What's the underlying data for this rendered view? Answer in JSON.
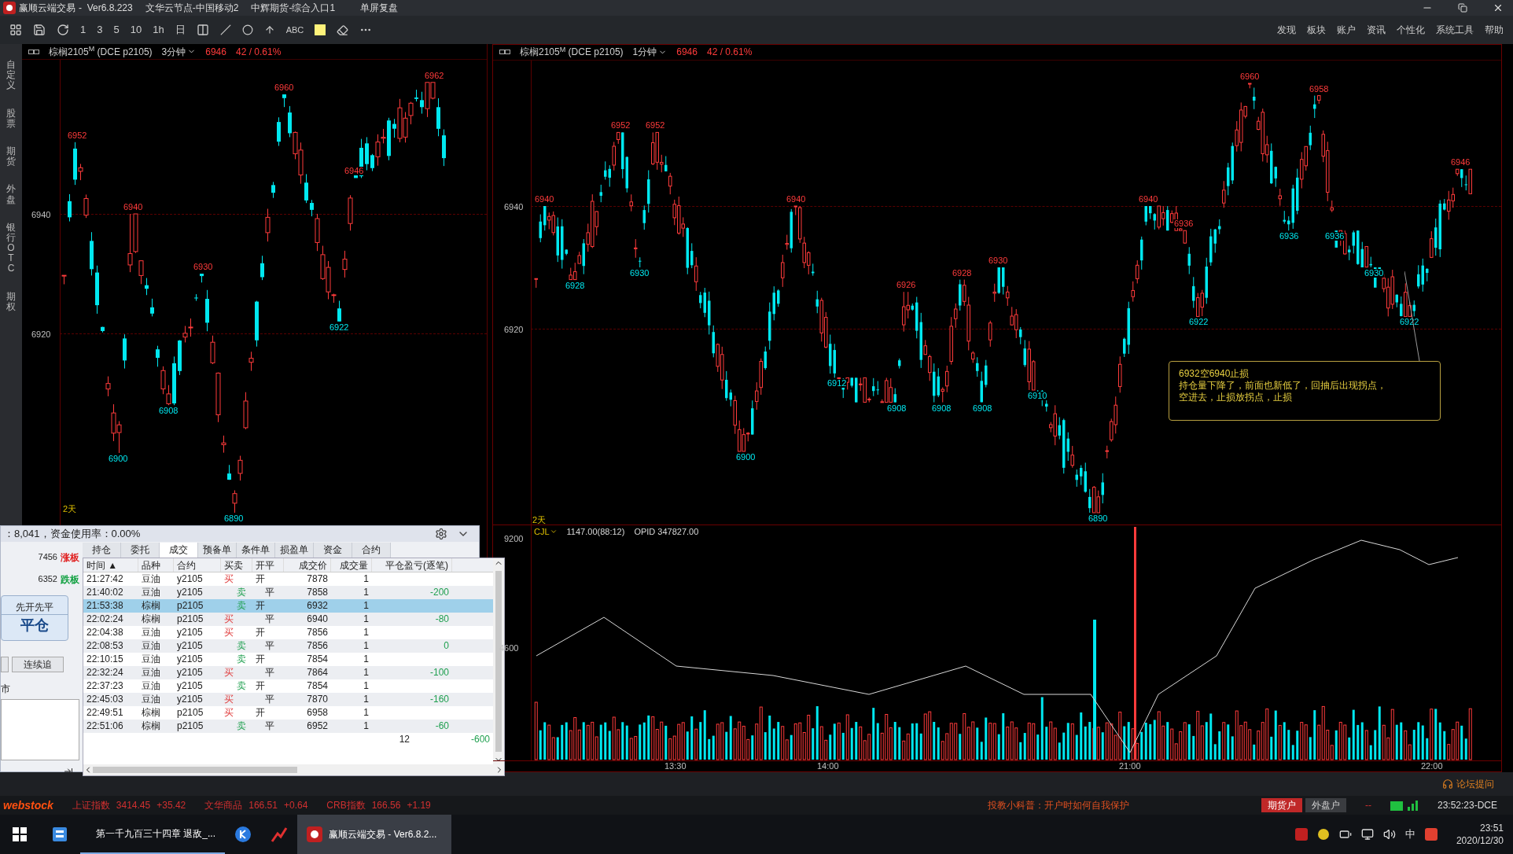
{
  "title_bar": {
    "app": "赢顺云端交易",
    "version": "-  Ver6.8.223",
    "server": "文华云节点-中国移动2",
    "broker": "中辉期货-综合入口1",
    "mode": "单屏复盘"
  },
  "toolbar": {
    "periods": [
      "1",
      "3",
      "5",
      "10",
      "1h",
      "日"
    ],
    "text_tool": "ABC",
    "menus": [
      "发现",
      "板块",
      "账户",
      "资讯",
      "个性化",
      "系统工具",
      "帮助"
    ]
  },
  "side_tabs": [
    "自定义",
    "股票",
    "期货",
    "外盘",
    "银行OTC",
    "期权"
  ],
  "charts": [
    {
      "symbol": "棕榈2105",
      "mark": "M",
      "exchange": "(DCE p2105)",
      "period": "3分钟",
      "price": "6946",
      "change": "42 / 0.61%",
      "y_labels": [
        "6940",
        "6920"
      ],
      "days": "2天",
      "price_labels": [
        {
          "text": "6952",
          "kind": "high"
        },
        {
          "text": "6900",
          "kind": "low"
        },
        {
          "text": "6940",
          "kind": "high"
        },
        {
          "text": "6908",
          "kind": "low"
        },
        {
          "text": "6930",
          "kind": "high"
        },
        {
          "text": "6890",
          "kind": "low"
        },
        {
          "text": "6960",
          "kind": "high"
        },
        {
          "text": "6922",
          "kind": "low"
        },
        {
          "text": "6946",
          "kind": "high"
        },
        {
          "text": "6962",
          "kind": "high"
        }
      ]
    },
    {
      "symbol": "棕榈2105",
      "mark": "M",
      "exchange": "(DCE p2105)",
      "period": "1分钟",
      "price": "6946",
      "change": "42 / 0.61%",
      "y_labels": [
        "6940",
        "6920"
      ],
      "days": "2天",
      "price_labels": [
        {
          "text": "6940",
          "kind": "high"
        },
        {
          "text": "6928",
          "kind": "low"
        },
        {
          "text": "6952",
          "kind": "high"
        },
        {
          "text": "6930",
          "kind": "low"
        },
        {
          "text": "6952",
          "kind": "high"
        },
        {
          "text": "6900",
          "kind": "low"
        },
        {
          "text": "6940",
          "kind": "high"
        },
        {
          "text": "6912",
          "kind": "low"
        },
        {
          "text": "6908",
          "kind": "low"
        },
        {
          "text": "6926",
          "kind": "high"
        },
        {
          "text": "6908",
          "kind": "low"
        },
        {
          "text": "6928",
          "kind": "high"
        },
        {
          "text": "6908",
          "kind": "low"
        },
        {
          "text": "6930",
          "kind": "high"
        },
        {
          "text": "6910",
          "kind": "low"
        },
        {
          "text": "6890",
          "kind": "low"
        },
        {
          "text": "6940",
          "kind": "high"
        },
        {
          "text": "6936",
          "kind": "high"
        },
        {
          "text": "6922",
          "kind": "low"
        },
        {
          "text": "6960",
          "kind": "high"
        },
        {
          "text": "6936",
          "kind": "low"
        },
        {
          "text": "6958",
          "kind": "high"
        },
        {
          "text": "6936",
          "kind": "low"
        },
        {
          "text": "6930",
          "kind": "low"
        },
        {
          "text": "6922",
          "kind": "low"
        },
        {
          "text": "6946",
          "kind": "high"
        }
      ],
      "note": [
        "6932空6940止损",
        "持仓量下降了，前面也新低了，回抽后出现拐点，",
        "空进去，止损放拐点，止损"
      ],
      "volume": {
        "indicator": "CJL",
        "value": "1147.00(88:12)",
        "opid": "OPID 347827.00",
        "y_labels": [
          "9200",
          "4600"
        ]
      },
      "time_labels": [
        "13:30",
        "14:00",
        "21:00",
        "22:00"
      ]
    }
  ],
  "trade_panel": {
    "summary": "：8,041，资金使用率：0.00%",
    "limits": [
      {
        "price": "7456",
        "label": "涨板",
        "kind": "up"
      },
      {
        "price": "6352",
        "label": "跌板",
        "kind": "down"
      }
    ],
    "mode_button": {
      "top": "先开先平",
      "main": "平仓"
    },
    "chase_button": "连续追",
    "market_label": "市",
    "tabs": [
      {
        "label": "持仓",
        "selected": false
      },
      {
        "label": "委托",
        "selected": false
      },
      {
        "label": "成交",
        "selected": true
      },
      {
        "label": "预备单",
        "selected": false
      },
      {
        "label": "条件单",
        "selected": false
      },
      {
        "label": "损盈单",
        "selected": false
      },
      {
        "label": "资金",
        "selected": false
      },
      {
        "label": "合约",
        "selected": false
      }
    ],
    "columns": [
      "时间 ▲",
      "品种",
      "合约",
      "买卖",
      "开平",
      "成交价",
      "成交量",
      "平仓盈亏(逐笔)"
    ],
    "rows": [
      {
        "time": "21:27:42",
        "product": "豆油",
        "contract": "y2105",
        "side": "买",
        "buy": true,
        "offset": "开",
        "open": true,
        "price": "7878",
        "qty": "1",
        "selected": false
      },
      {
        "time": "21:40:02",
        "product": "豆油",
        "contract": "y2105",
        "side": "卖",
        "buy": false,
        "offset": "平",
        "open": false,
        "price": "7858",
        "qty": "1",
        "pnl": "-200",
        "selected": false
      },
      {
        "time": "21:53:38",
        "product": "棕榈",
        "contract": "p2105",
        "side": "卖",
        "buy": false,
        "offset": "开",
        "open": true,
        "price": "6932",
        "qty": "1",
        "selected": true
      },
      {
        "time": "22:02:24",
        "product": "棕榈",
        "contract": "p2105",
        "side": "买",
        "buy": true,
        "offset": "平",
        "open": false,
        "price": "6940",
        "qty": "1",
        "pnl": "-80",
        "selected": false
      },
      {
        "time": "22:04:38",
        "product": "豆油",
        "contract": "y2105",
        "side": "买",
        "buy": true,
        "offset": "开",
        "open": true,
        "price": "7856",
        "qty": "1",
        "selected": false
      },
      {
        "time": "22:08:53",
        "product": "豆油",
        "contract": "y2105",
        "side": "卖",
        "buy": false,
        "offset": "平",
        "open": false,
        "price": "7856",
        "qty": "1",
        "pnl": "0",
        "selected": false
      },
      {
        "time": "22:10:15",
        "product": "豆油",
        "contract": "y2105",
        "side": "卖",
        "buy": false,
        "offset": "开",
        "open": true,
        "price": "7854",
        "qty": "1",
        "selected": false
      },
      {
        "time": "22:32:24",
        "product": "豆油",
        "contract": "y2105",
        "side": "买",
        "buy": true,
        "offset": "平",
        "open": false,
        "price": "7864",
        "qty": "1",
        "pnl": "-100",
        "selected": false
      },
      {
        "time": "22:37:23",
        "product": "豆油",
        "contract": "y2105",
        "side": "卖",
        "buy": false,
        "offset": "开",
        "open": true,
        "price": "7854",
        "qty": "1",
        "selected": false
      },
      {
        "time": "22:45:03",
        "product": "豆油",
        "contract": "y2105",
        "side": "买",
        "buy": true,
        "offset": "平",
        "open": false,
        "price": "7870",
        "qty": "1",
        "pnl": "-160",
        "selected": false
      },
      {
        "time": "22:49:51",
        "product": "棕榈",
        "contract": "p2105",
        "side": "买",
        "buy": true,
        "offset": "开",
        "open": true,
        "price": "6958",
        "qty": "1",
        "selected": false
      },
      {
        "time": "22:51:06",
        "product": "棕榈",
        "contract": "p2105",
        "side": "卖",
        "buy": false,
        "offset": "平",
        "open": false,
        "price": "6952",
        "qty": "1",
        "pnl": "-60",
        "selected": false
      }
    ],
    "totals": {
      "qty": "12",
      "pnl": "-600"
    }
  },
  "forum": "论坛提问",
  "status_bar": {
    "logo": "webstock",
    "indices": [
      {
        "name": "上证指数",
        "value": "3414.45",
        "change": "+35.42"
      },
      {
        "name": "文华商品",
        "value": "166.51",
        "change": "+0.64"
      },
      {
        "name": "CRB指数",
        "value": "166.56",
        "change": "+1.19"
      }
    ],
    "tip": "投教小科普：开户时如何自我保护",
    "accounts": [
      {
        "label": "期货户",
        "selected": true
      },
      {
        "label": "外盘户",
        "selected": false
      }
    ],
    "link": "--",
    "clock": "23:52:23-DCE"
  },
  "taskbar": {
    "windows": [
      {
        "label": "第一千九百三十四章 退敌_...",
        "selected": false
      },
      {
        "label": "赢顺云端交易  -  Ver6.8.2...",
        "selected": true
      }
    ],
    "ime": "中",
    "time": "23:51",
    "date": "2020/12/30"
  }
}
